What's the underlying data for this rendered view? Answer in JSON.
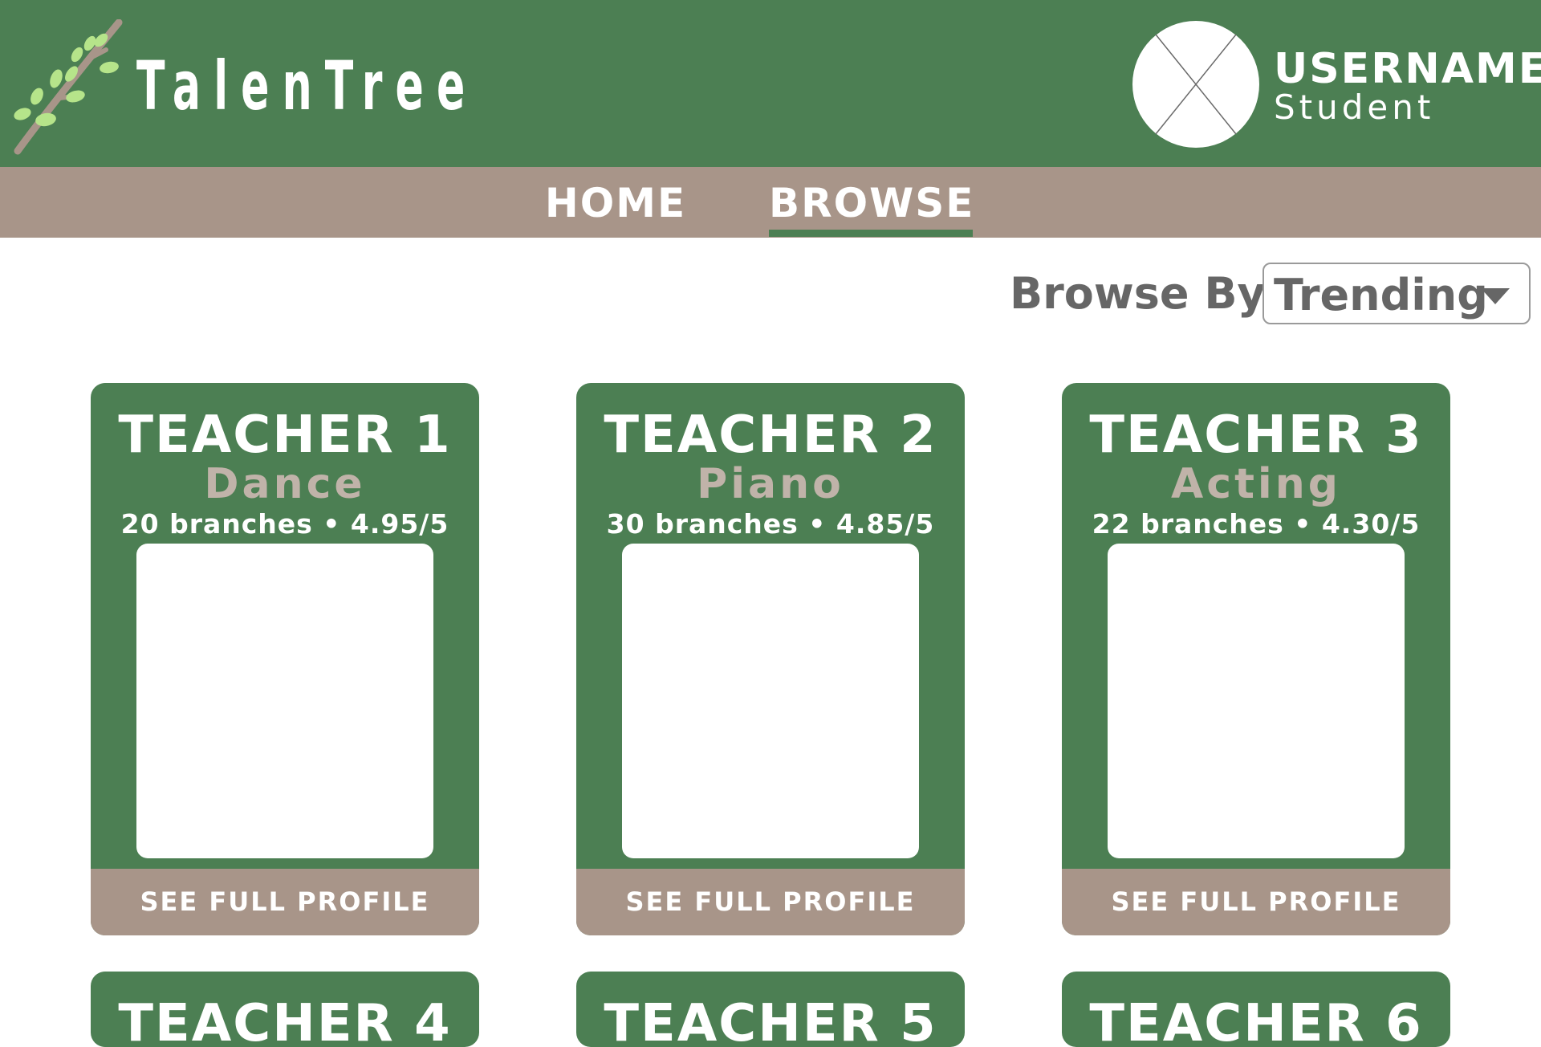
{
  "header": {
    "brand": "TalenTree",
    "username": "USERNAME",
    "role": "Student"
  },
  "nav": {
    "home": "HOME",
    "browse": "BROWSE",
    "active": "BROWSE"
  },
  "browse": {
    "label": "Browse By",
    "selected": "Trending"
  },
  "colors": {
    "primary_green": "#4c7f53",
    "taupe": "#a89589",
    "skill_text": "#c0b3a9",
    "leaf_green": "#b6e48a"
  },
  "teachers": [
    {
      "name": "TEACHER 1",
      "skill": "Dance",
      "stats": "20 branches • 4.95/5",
      "button": "SEE FULL PROFILE"
    },
    {
      "name": "TEACHER 2",
      "skill": "Piano",
      "stats": "30 branches • 4.85/5",
      "button": "SEE FULL PROFILE"
    },
    {
      "name": "TEACHER 3",
      "skill": "Acting",
      "stats": "22 branches • 4.30/5",
      "button": "SEE FULL PROFILE"
    },
    {
      "name": "TEACHER 4"
    },
    {
      "name": "TEACHER 5"
    },
    {
      "name": "TEACHER 6"
    }
  ]
}
